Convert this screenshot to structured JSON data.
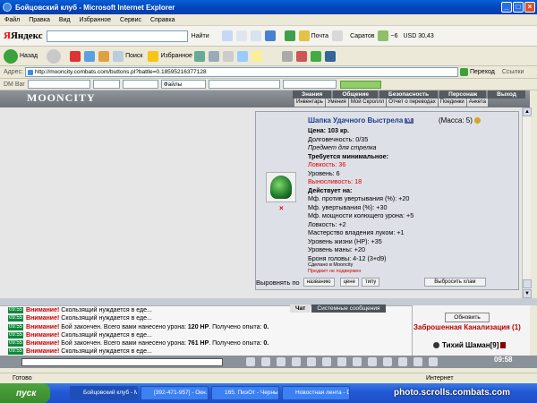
{
  "window": {
    "title": "Бойцовский клуб - Microsoft Internet Explorer"
  },
  "menu": [
    "Файл",
    "Правка",
    "Вид",
    "Избранное",
    "Сервис",
    "Справка"
  ],
  "yandex_bar": {
    "logo": "Яндекс",
    "find_label": "Найти",
    "mail_label": "Почта",
    "city_weather": "Саратов",
    "temperature": "−6",
    "currency": "USD 30,43"
  },
  "nav": {
    "back_label": "Назад",
    "search_label": "Поиск",
    "favorites_label": "Избранное"
  },
  "address": {
    "label": "Адрес:",
    "url": "http://mooncity.combats.com/buttons.pl?battle=0.18595216377128",
    "go_label": "Переход",
    "links_label": "Ссылки"
  },
  "dm_bar": {
    "label": "DM Bar",
    "files_label": "Файлы"
  },
  "game": {
    "logo": "MOONCITY",
    "menu_top": [
      "Знания",
      "Общение",
      "Безопасность",
      "Персонаж",
      "Выход"
    ],
    "menu_bottom": [
      "Инвентарь",
      "Умения",
      "Мой Скроллл",
      "Отчет о переводах",
      "Поединки",
      "Анкета"
    ]
  },
  "item": {
    "name": "Шапка Удачного Выстрела",
    "badge": "VI",
    "mass": "(Масса: 5)",
    "price": "Цена: 103 кр.",
    "durability": "Долговечность: 0/35",
    "for_class": "Предмет для стрелка",
    "req_title": "Требуется минимальное:",
    "requirements": [
      {
        "text": "Ловкость: 36",
        "unmet": true
      },
      {
        "text": "Уровень: 6",
        "unmet": false
      },
      {
        "text": "Выносливость: 18",
        "unmet": true
      }
    ],
    "effects_title": "Действует на:",
    "effects": [
      "Мф. против увертывания (%): +20",
      "Мф. увертывания (%): +30",
      "Мф. мощности колющего урона: +5",
      "Ловкость: +2",
      "Мастерство владения луком: +1",
      "Уровень жизни (HP): +35",
      "Уровень маны: +20",
      "Броня головы: 4-12 (3+d9)"
    ],
    "made_in": "Сделано в Mooncity",
    "engraving": "Предмет не подвержен"
  },
  "sort": {
    "label": "Выровнять по",
    "buttons": [
      "названию",
      "цене",
      "типу"
    ],
    "throw_label": "Выбросить хлам"
  },
  "chat": {
    "tabs": [
      "Чат",
      "Системные сообщения"
    ],
    "lines": [
      {
        "time": "09:55",
        "parts": [
          {
            "t": "Внимание! ",
            "c": "warn"
          },
          {
            "t": "Скользящий нуждается в еде..."
          }
        ]
      },
      {
        "time": "09:55",
        "parts": [
          {
            "t": "Внимание! ",
            "c": "warn"
          },
          {
            "t": "Скользящий нуждается в еде..."
          }
        ]
      },
      {
        "time": "09:55",
        "parts": [
          {
            "t": "Внимание! ",
            "c": "warn"
          },
          {
            "t": "Бой закончен. Всего вами нанесено урона: "
          },
          {
            "t": "120 HP",
            "c": "b"
          },
          {
            "t": ". Получено опыта: "
          },
          {
            "t": "0.",
            "c": "b"
          }
        ]
      },
      {
        "time": "09:55",
        "parts": [
          {
            "t": "Внимание! ",
            "c": "warn"
          },
          {
            "t": "Скользящий нуждается в еде..."
          }
        ]
      },
      {
        "time": "09:55",
        "parts": [
          {
            "t": "Внимание! ",
            "c": "warn"
          },
          {
            "t": "Бой закончен. Всего вами нанесено урона: "
          },
          {
            "t": "761 HP",
            "c": "b"
          },
          {
            "t": ". Получено опыта: "
          },
          {
            "t": "0.",
            "c": "b"
          }
        ]
      },
      {
        "time": "09:55",
        "parts": [
          {
            "t": "Внимание! ",
            "c": "warn"
          },
          {
            "t": "Скользящий нуждается в еде..."
          }
        ]
      }
    ]
  },
  "side": {
    "refresh_label": "Обновить",
    "location": "Заброшенная Канализация (1)",
    "player": "Тихий Шаман",
    "player_level": "[9]"
  },
  "clock": "09:58",
  "status": {
    "text": "Готово",
    "zone": "Интернет"
  },
  "taskbar": {
    "start": "пуск",
    "tasks": [
      "Бойцовский клуб - M...",
      "[392-471-957] - Окн...",
      "165. ПиэОт - Черны...",
      "Новостная лента - D..."
    ]
  },
  "watermark": "photo.scrolls.combats.com"
}
